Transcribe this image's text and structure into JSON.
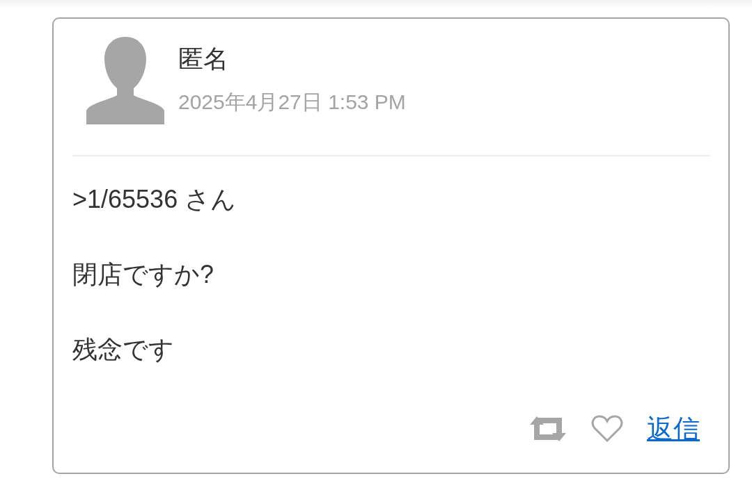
{
  "comment": {
    "author": "匿名",
    "date": "2025年4月27日 1:53 PM",
    "paragraphs": [
      ">1/65536 さん",
      "閉店ですか?",
      "残念です"
    ],
    "liked": false,
    "reply_label": "返信"
  }
}
